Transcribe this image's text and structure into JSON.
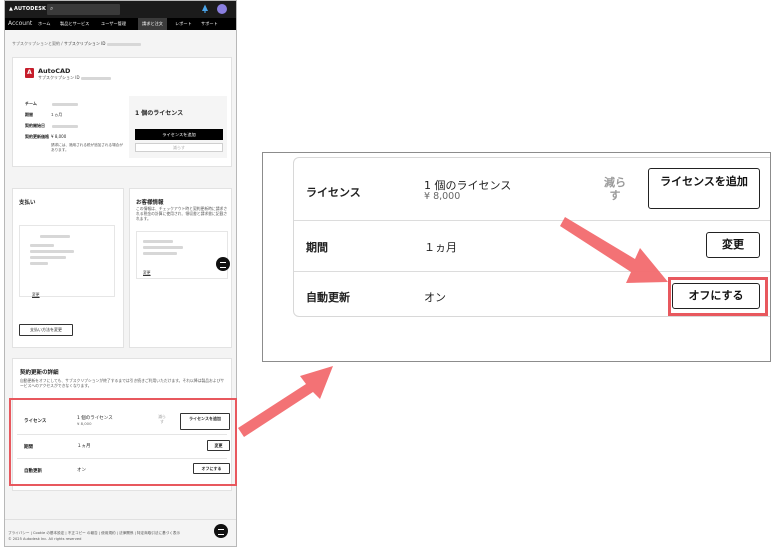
{
  "header": {
    "brand": "AUTODESK",
    "app_name": "Account",
    "nav": [
      "ホーム",
      "製品とサービス",
      "ユーザー管理",
      "請求と注文",
      "レポート",
      "サポート"
    ],
    "active_nav": "請求と注文"
  },
  "breadcrumb": {
    "parent": "サブスクリプションと契約",
    "separator": "/",
    "current": "サブスクリプション ID"
  },
  "product": {
    "name": "AutoCAD",
    "subtitle": "サブスクリプション ID",
    "fields": [
      {
        "label": "チーム"
      },
      {
        "label": "期間",
        "value": "１ヵ月"
      },
      {
        "label": "契約開始日"
      },
      {
        "label": "契約更新価格",
        "value": "¥ 8,000"
      }
    ],
    "note": "請求には、適用される税が追加される場合があります。",
    "license_count": "1 個のライセンス",
    "add_license_button": "ライセンスを追加",
    "reduce_button": "減らす"
  },
  "payment": {
    "title": "支払い",
    "change_link": "変更",
    "change_method_button": "支払い方法を変更"
  },
  "customer_info": {
    "title": "お客様情報",
    "description": "この情報は、チェックアウト時と契約更新時に請求される税金の計算に使用され、領収書と請求書に記載されます。",
    "change_link": "変更"
  },
  "renewal": {
    "title": "契約更新の詳細",
    "description": "自動更新をオフにしても、サブスクリプションが終了するまでは引き続きご利用いただけます。それ以降は製品およびサービスへのアクセスができなくなります。"
  },
  "renewal_rows": {
    "license": {
      "label": "ライセンス",
      "value": "1 個のライセンス",
      "price": "¥ 8,000",
      "reduce": "減らす",
      "action": "ライセンスを追加"
    },
    "term": {
      "label": "期間",
      "value": "１ヵ月",
      "action": "変更"
    },
    "auto_renew": {
      "label": "自動更新",
      "value": "オン",
      "action": "オフにする"
    }
  },
  "footer": {
    "links": "プライバシー | Cookie の基本設定 | 不正コピー の報告 | 使用規約 | 法律関係 | 特定商取引法に基づく表示",
    "copyright": "© 2025 Autodesk Inc. All rights reserved"
  },
  "colors": {
    "highlight": "#e8585e",
    "nav_bg": "#000000",
    "product_icon": "#c61d2b"
  }
}
